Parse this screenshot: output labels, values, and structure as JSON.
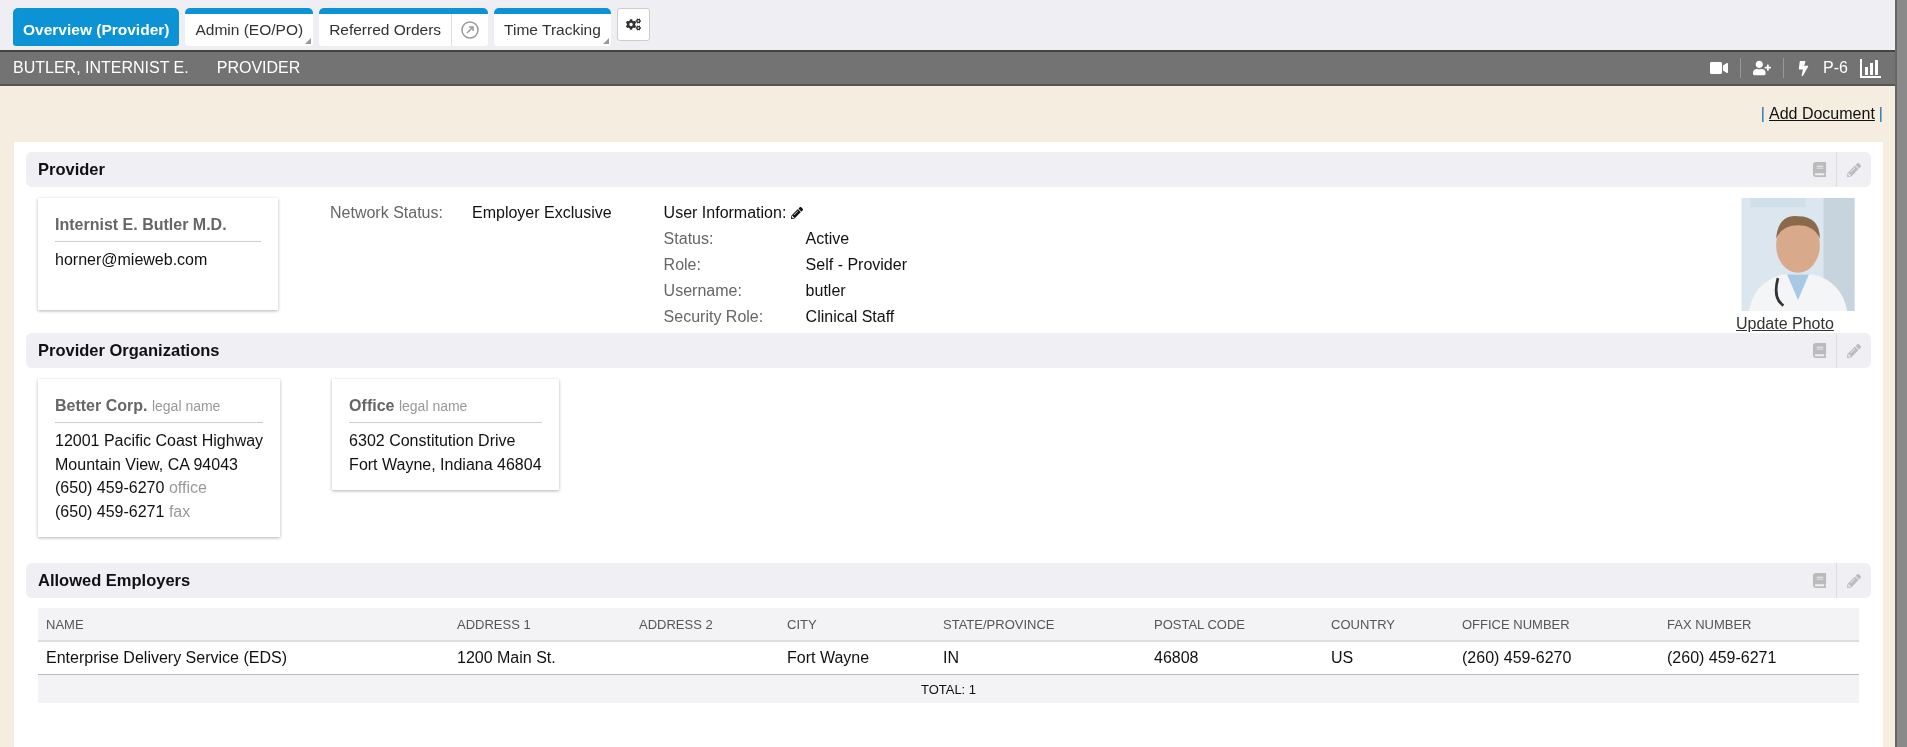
{
  "tabs": [
    {
      "label": "Overview (Provider)",
      "selected": true,
      "kind": "plain"
    },
    {
      "label": "Admin (EO/PO)",
      "selected": false,
      "kind": "dropdown"
    },
    {
      "label": "Referred Orders",
      "selected": false,
      "kind": "external"
    },
    {
      "label": "Time Tracking",
      "selected": false,
      "kind": "dropdown"
    }
  ],
  "header": {
    "name": "BUTLER, INTERNIST E.",
    "role": "PROVIDER",
    "code": "P-6"
  },
  "actions": {
    "separator": "|",
    "link": "Add Document"
  },
  "provider": {
    "title": "Provider",
    "card": {
      "name": "Internist E. Butler M.D.",
      "email": "horner@mieweb.com"
    },
    "network_status": {
      "label": "Network Status:",
      "value": "Employer Exclusive"
    },
    "user_info": {
      "title": "User Information:",
      "fields": [
        {
          "label": "Status:",
          "value": "Active"
        },
        {
          "label": "Role:",
          "value": "Self - Provider"
        },
        {
          "label": "Username:",
          "value": "butler"
        },
        {
          "label": "Security Role:",
          "value": "Clinical Staff"
        }
      ]
    },
    "photo": {
      "kind": "picture",
      "link": "Update Photo"
    }
  },
  "organizations": {
    "title": "Provider Organizations",
    "cards": [
      {
        "name": "Better Corp.",
        "note": "legal name",
        "lines": [
          {
            "text": "12001 Pacific Coast Highway"
          },
          {
            "text": "Mountain View, CA 94043"
          },
          {
            "text": "(650) 459-6270",
            "note": "office"
          },
          {
            "text": "(650) 459-6271",
            "note": "fax"
          }
        ]
      },
      {
        "name": "Office",
        "note": "legal name",
        "lines": [
          {
            "text": "6302 Constitution Drive"
          },
          {
            "text": "Fort Wayne, Indiana 46804"
          }
        ]
      }
    ]
  },
  "employers": {
    "title": "Allowed Employers",
    "columns": [
      "NAME",
      "ADDRESS 1",
      "ADDRESS 2",
      "CITY",
      "STATE/PROVINCE",
      "POSTAL CODE",
      "COUNTRY",
      "OFFICE NUMBER",
      "FAX NUMBER"
    ],
    "rows": [
      [
        "Enterprise Delivery Service (EDS)",
        "1200 Main St.",
        "",
        "Fort Wayne",
        "IN",
        "46808",
        "US",
        "(260) 459-6270",
        "(260) 459-6271"
      ]
    ],
    "total": "TOTAL: 1"
  }
}
